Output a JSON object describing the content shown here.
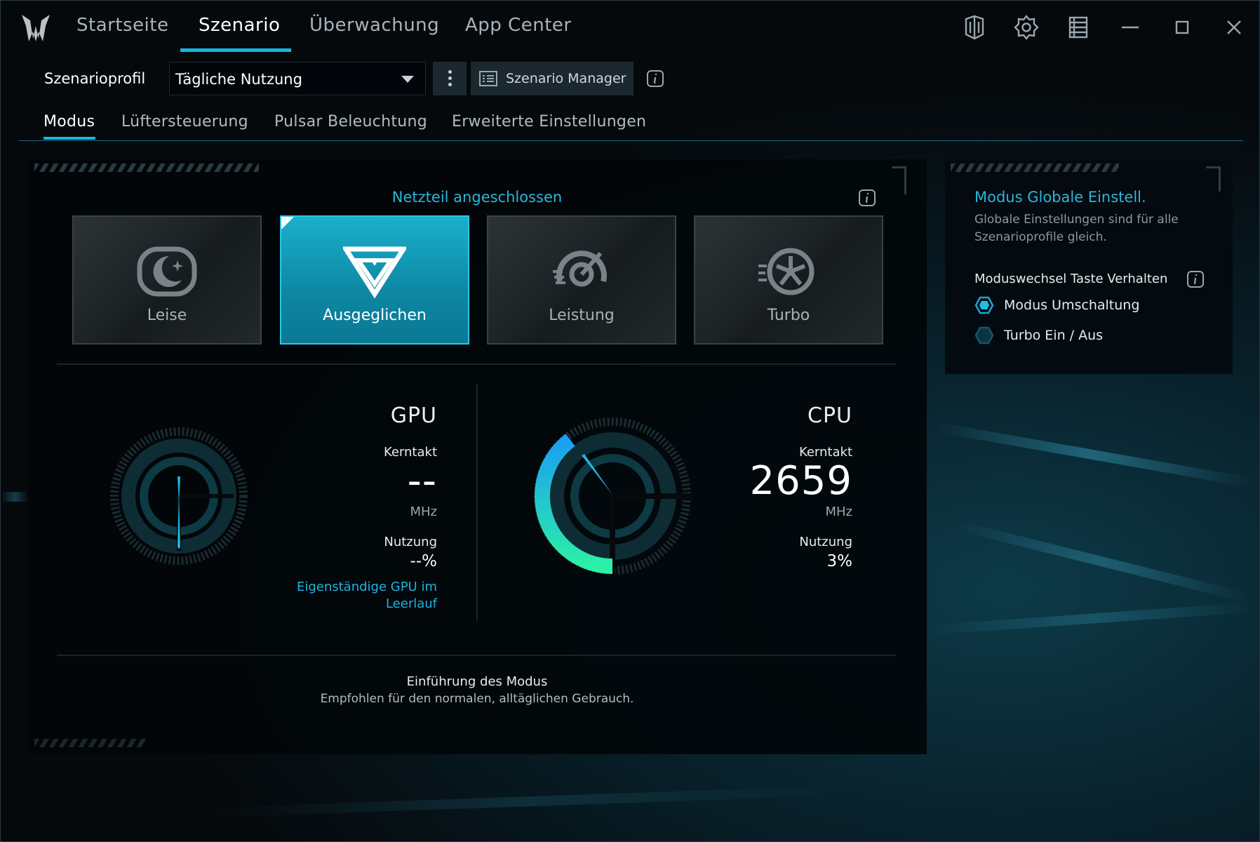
{
  "nav": {
    "tabs": [
      {
        "label": "Startseite"
      },
      {
        "label": "Szenario"
      },
      {
        "label": "Überwachung"
      },
      {
        "label": "App Center"
      }
    ],
    "active": "Szenario"
  },
  "profile": {
    "label": "Szenarioprofil",
    "selected": "Tägliche Nutzung",
    "manager_label": "Szenario Manager"
  },
  "subtabs": [
    {
      "label": "Modus"
    },
    {
      "label": "Lüftersteuerung"
    },
    {
      "label": "Pulsar Beleuchtung"
    },
    {
      "label": "Erweiterte Einstellungen"
    }
  ],
  "main": {
    "power_status": "Netzteil angeschlossen",
    "modes": [
      {
        "label": "Leise",
        "icon": "moon-icon"
      },
      {
        "label": "Ausgeglichen",
        "icon": "balanced-icon"
      },
      {
        "label": "Leistung",
        "icon": "speedometer-icon"
      },
      {
        "label": "Turbo",
        "icon": "turbo-fan-icon"
      }
    ],
    "active_mode": "Ausgeglichen",
    "gpu": {
      "title": "GPU",
      "clock_label": "Kerntakt",
      "clock_value": "--",
      "clock_unit": "MHz",
      "usage_label": "Nutzung",
      "usage_value": "--%",
      "idle_text_line1": "Eigenständige GPU im",
      "idle_text_line2": "Leerlauf"
    },
    "cpu": {
      "title": "CPU",
      "clock_label": "Kerntakt",
      "clock_value": "2659",
      "clock_unit": "MHz",
      "usage_label": "Nutzung",
      "usage_value": "3%"
    },
    "intro_title": "Einführung des Modus",
    "intro_text": "Empfohlen für den normalen, alltäglichen Gebrauch."
  },
  "side": {
    "title": "Modus Globale Einstell.",
    "desc": "Globale Einstellungen sind für alle Szenarioprofile gleich.",
    "sub": "Moduswechsel Taste Verhalten",
    "options": [
      {
        "label": "Modus Umschaltung",
        "selected": true
      },
      {
        "label": "Turbo Ein / Aus",
        "selected": false
      }
    ]
  },
  "colors": {
    "accent": "#19b7e0",
    "active_card": "#0d87a3",
    "gauge_start": "#1aa0f0",
    "gauge_end": "#2af0a8"
  }
}
